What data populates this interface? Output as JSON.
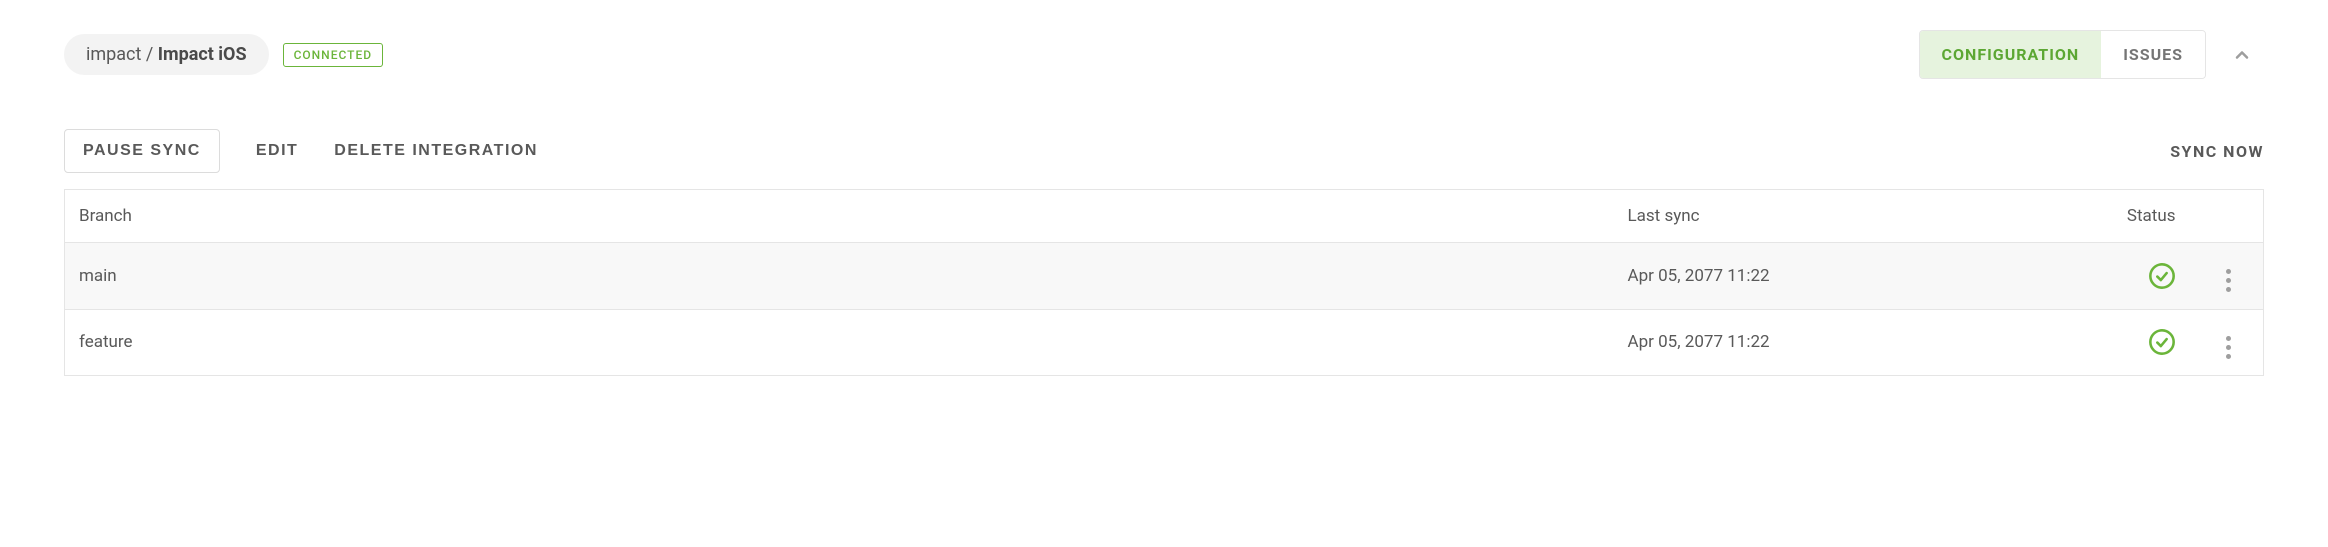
{
  "header": {
    "breadcrumb_parent": "impact",
    "breadcrumb_sep": " / ",
    "breadcrumb_current": "Impact iOS",
    "status_badge": "CONNECTED"
  },
  "tabs": {
    "configuration": "CONFIGURATION",
    "issues": "ISSUES"
  },
  "actions": {
    "pause_sync": "PAUSE SYNC",
    "edit": "EDIT",
    "delete_integration": "DELETE INTEGRATION",
    "sync_now": "SYNC NOW"
  },
  "table": {
    "headers": {
      "branch": "Branch",
      "last_sync": "Last sync",
      "status": "Status"
    },
    "rows": [
      {
        "branch": "main",
        "last_sync": "Apr 05, 2077 11:22",
        "status": "ok"
      },
      {
        "branch": "feature",
        "last_sync": "Apr 05, 2077 11:22",
        "status": "ok"
      }
    ]
  },
  "colors": {
    "accent_green": "#6bb53a"
  }
}
